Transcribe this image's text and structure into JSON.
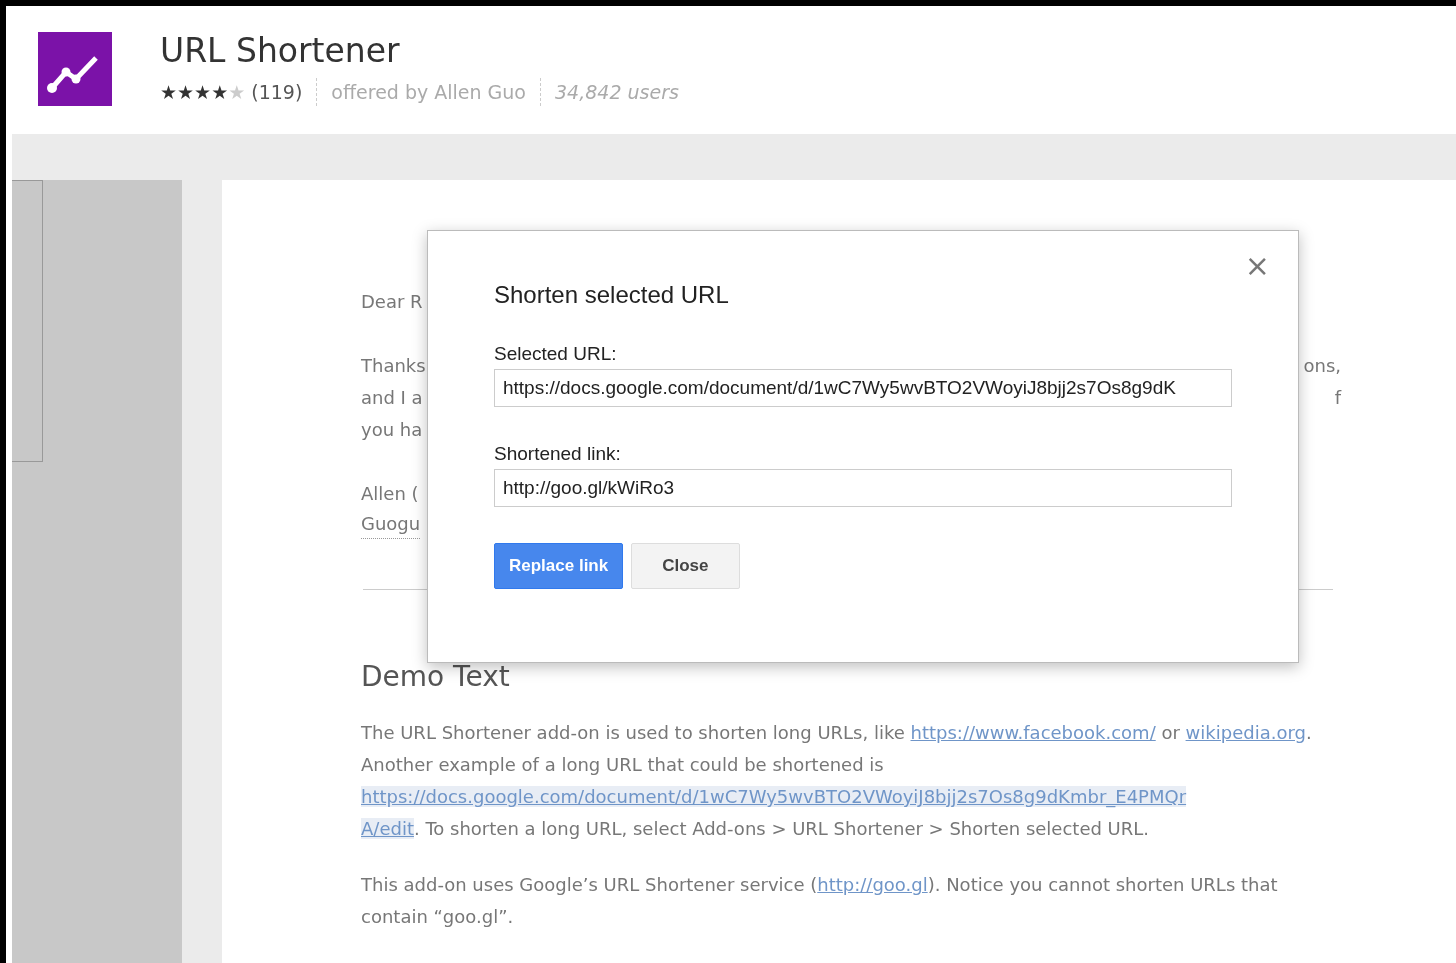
{
  "extension": {
    "name": "URL Shortener",
    "stars": 4,
    "rating_count": "(119)",
    "offered_by": "offered by Allen Guo",
    "users": "34,842 users"
  },
  "document": {
    "visible_lines": [
      {
        "left": "Dear R"
      },
      {
        "left": "Thanks",
        "right": "ons,"
      },
      {
        "left": "and I a",
        "right": "f"
      },
      {
        "left": "you ha"
      },
      {
        "left": "Allen ("
      },
      {
        "left": "Guogu"
      }
    ],
    "heading": "Demo Text",
    "paragraphs": [
      [
        {
          "kind": "text",
          "text": "The URL Shortener add-on is used to shorten long URLs, like "
        },
        {
          "kind": "link",
          "text": "https://www.facebook.com/"
        },
        {
          "kind": "text",
          "text": " or "
        },
        {
          "kind": "link",
          "text": "wikipedia.org"
        },
        {
          "kind": "text",
          "text": ". Another example of a long URL that could be shortened is "
        },
        {
          "kind": "selected_link",
          "text": "https://docs.google.com/document/d/1wC7Wy5wvBTO2VWoyiJ8bjj2s7Os8g9dKmbr_E4PMQr"
        },
        {
          "kind": "selected_link",
          "text": "A/edit"
        },
        {
          "kind": "text",
          "text": ". To shorten a long URL, select Add-ons > URL Shortener > Shorten selected URL."
        }
      ],
      [
        {
          "kind": "text",
          "text": "This add-on uses Google’s URL Shortener service ("
        },
        {
          "kind": "link",
          "text": "http://goo.gl"
        },
        {
          "kind": "text",
          "text": "). Notice you cannot shorten URLs that contain “goo.gl”."
        }
      ]
    ]
  },
  "dialog": {
    "title": "Shorten selected URL",
    "close": "×",
    "fields": [
      {
        "label": "Selected URL:",
        "value": "https://docs.google.com/document/d/1wC7Wy5wvBTO2VWoyiJ8bjj2s7Os8g9dK"
      },
      {
        "label": "Shortened link:",
        "value": "http://goo.gl/kWiRo3"
      }
    ],
    "buttons": [
      {
        "label": "Replace link",
        "kind": "primary"
      },
      {
        "label": "Close",
        "kind": "secondary"
      }
    ]
  }
}
